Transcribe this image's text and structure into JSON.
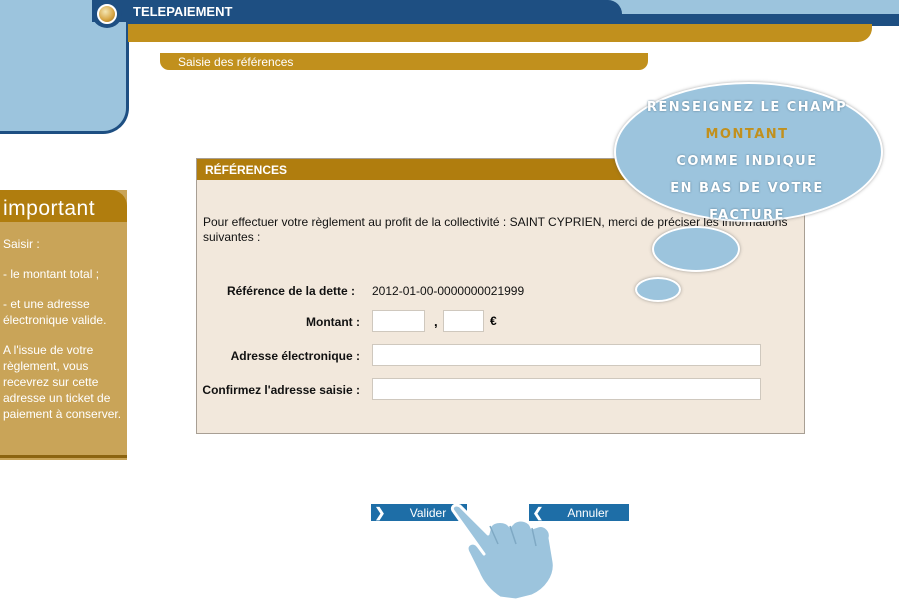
{
  "header": {
    "app_title": "TELEPAIEMENT",
    "subtitle": "Saisie des références"
  },
  "sidebar": {
    "title": "important",
    "paragraphs": [
      "Saisir :",
      "- le montant total ;",
      "- et une adresse électronique valide.",
      "A l'issue de votre règlement, vous recevrez sur cette adresse un ticket de paiement à conserver."
    ]
  },
  "form": {
    "section_title": "RÉFÉRENCES",
    "intro": "Pour effectuer votre règlement au profit de la collectivité : SAINT CYPRIEN, merci de préciser les informations suivantes :",
    "reference_label": "Référence de la dette :",
    "reference_value": "2012-01-00-0000000021999",
    "amount_label": "Montant :",
    "amount_integer": "",
    "amount_separator": ",",
    "amount_decimal": "",
    "currency": "€",
    "email_label": "Adresse électronique :",
    "email_value": "",
    "confirm_label": "Confirmez l'adresse saisie :",
    "confirm_value": ""
  },
  "buttons": {
    "validate_label": "Valider",
    "cancel_label": "Annuler"
  },
  "tooltip": {
    "line1": "RENSEIGNEZ LE CHAMP",
    "line2": "MONTANT",
    "line3": "COMME INDIQUE",
    "line4": "EN BAS DE VOTRE FACTURE"
  },
  "colors": {
    "navy": "#1e4f82",
    "gold": "#c1901d",
    "light_blue": "#9cc4dd",
    "button_blue": "#1e6ea7",
    "form_bg": "#f2e8dc"
  },
  "icons": {
    "logo": "logo-circle-icon",
    "validate": "chevron-right-icon",
    "cancel": "chevron-left-icon",
    "pointer": "pointing-hand-icon"
  }
}
